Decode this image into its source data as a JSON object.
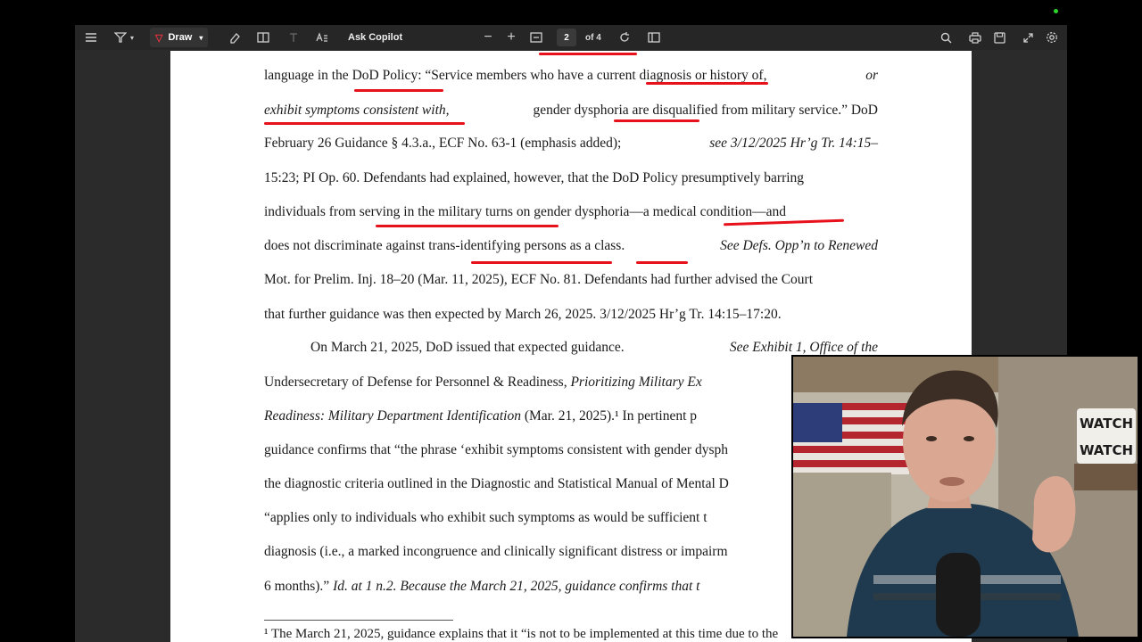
{
  "toolbar": {
    "draw_label": "Draw",
    "ask_copilot_label": "Ask Copilot",
    "page_current": "2",
    "page_total_label": "of 4",
    "icons": [
      "list-icon",
      "filter-icon",
      "chevron-down-icon",
      "draw-pen-icon",
      "eraser-icon",
      "read-mode-icon",
      "text-icon",
      "immersive-reader-icon",
      "zoom-out-icon",
      "zoom-in-icon",
      "fit-page-icon",
      "rotate-icon",
      "page-view-icon",
      "search-icon",
      "print-icon",
      "save-icon",
      "fullscreen-icon",
      "settings-icon"
    ]
  },
  "document": {
    "lines": [
      [
        "language in the DoD Policy: “Service members who have a current diagnosis or history of,",
        "or"
      ],
      [
        "exhibit symptoms consistent with,",
        "gender dysphoria are disqualified from military service.” DoD"
      ],
      [
        "February 26 Guidance § 4.3.a., ECF No. 63-1 (emphasis added);",
        "see 3/12/2025 Hr’g Tr. 14:15–"
      ],
      [
        "15:23; PI Op. 60. Defendants had explained, however, that the DoD Policy presumptively barring"
      ],
      [
        "individuals from serving in the military turns on gender dysphoria—a medical condition—and"
      ],
      [
        "does not discriminate against trans-identifying persons as a class.",
        "See Defs. Opp’n to Renewed"
      ],
      [
        "Mot. for Prelim. Inj. 18–20 (Mar. 11, 2025), ECF No. 81. Defendants had further advised the Court"
      ],
      [
        "that further guidance was then expected by March 26, 2025. 3/12/2025 Hr’g Tr. 14:15–17:20."
      ],
      [
        "On March 21, 2025, DoD issued that expected guidance.",
        "See Exhibit 1, Office of the"
      ],
      [
        "Undersecretary of Defense for Personnel & Readiness,",
        "Prioritizing Military Ex"
      ],
      [
        "Readiness: Military Department Identification",
        "(Mar. 21, 2025).¹ In pertinent p"
      ],
      [
        "guidance confirms that “the phrase ‘exhibit symptoms consistent with gender dysph"
      ],
      [
        "the diagnostic criteria outlined in the Diagnostic and Statistical Manual of Mental D"
      ],
      [
        "“applies only to individuals who exhibit such symptoms as would be sufficient t"
      ],
      [
        "diagnosis (i.e., a marked incongruence and clinically significant distress or impairm"
      ],
      [
        "6 months).”",
        "Id. at 1 n.2. Because the March 21, 2025, guidance confirms that t"
      ]
    ],
    "footnote": "¹ The March 21, 2025, guidance explains that it “is not to be implemented at this time due to the"
  },
  "webcam": {
    "sign_text_1": "WATCH",
    "sign_text_2": "WATCH"
  }
}
